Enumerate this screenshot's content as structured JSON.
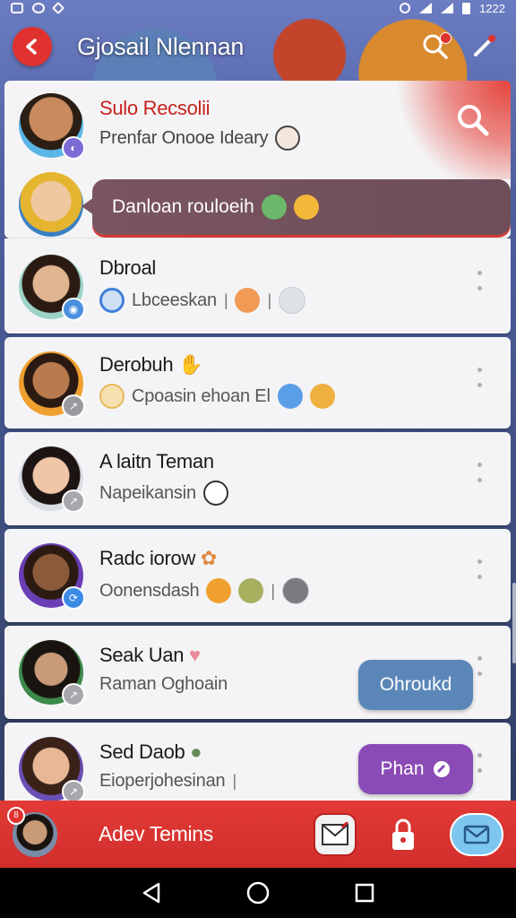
{
  "status_bar": {
    "time": "1222"
  },
  "header": {
    "title": "Gjosail Nlennan"
  },
  "contacts": [
    {
      "name": "Sulo Recsolii",
      "preview": "Prenfar Onooe Ideary"
    },
    {
      "bubble_text": "Danloan rouloeih"
    },
    {
      "name": "Dbroal",
      "preview": "Lbceeskan"
    },
    {
      "name": "Derobuh",
      "preview": "Cpoasin ehoan El"
    },
    {
      "name": "A laitn Teman",
      "preview": "Napeikansin"
    },
    {
      "name": "Radc iorow",
      "preview": "Oonensdash"
    },
    {
      "name": "Seak Uan",
      "preview": "Raman Oghoain",
      "action_label": "Ohroukd"
    },
    {
      "name": "Sed Daob",
      "preview": "Eioperjohesinan",
      "action_label": "Phan"
    }
  ],
  "bottom_bar": {
    "label": "Adev Temins",
    "avatar_badge": "8"
  },
  "colors": {
    "accent_red": "#e0322e",
    "action_blue": "#5b87b8",
    "action_purple": "#8a4bb6",
    "name_red": "#c8221d"
  },
  "icons": [
    "back-arrow-icon",
    "search-icon",
    "edit-pencil-icon",
    "more-dots-icon",
    "mail-icon",
    "lock-icon",
    "envelope-icon",
    "triangle-back-icon",
    "circle-home-icon",
    "square-recents-icon"
  ]
}
